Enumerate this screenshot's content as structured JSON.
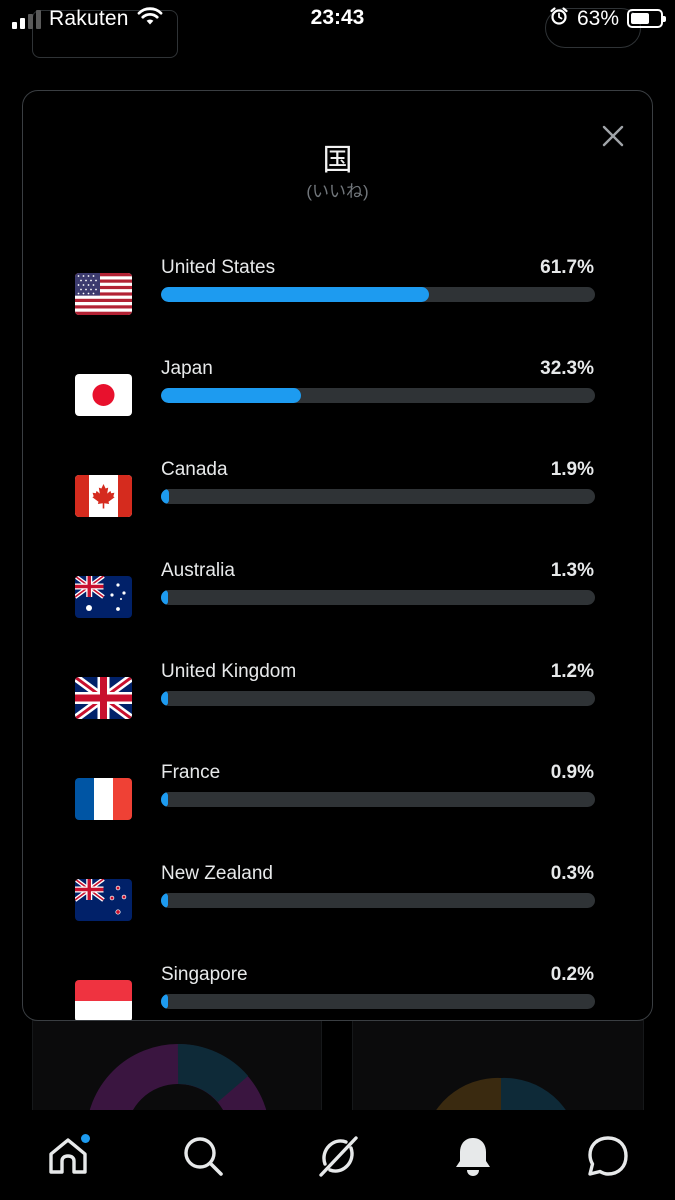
{
  "status_bar": {
    "carrier": "Rakuten",
    "time": "23:43",
    "battery": "63%",
    "battery_level": 0.63,
    "icons": [
      "signal-icon",
      "wifi-icon",
      "alarm-icon",
      "battery-icon"
    ]
  },
  "modal": {
    "title": "国",
    "subtitle": "(いいね)",
    "close_icon": "close-icon",
    "countries": [
      {
        "name": "United States",
        "percent": "61.7%",
        "value": 61.7,
        "flag": "us-flag-icon"
      },
      {
        "name": "Japan",
        "percent": "32.3%",
        "value": 32.3,
        "flag": "japan-flag-icon"
      },
      {
        "name": "Canada",
        "percent": "1.9%",
        "value": 1.9,
        "flag": "canada-flag-icon"
      },
      {
        "name": "Australia",
        "percent": "1.3%",
        "value": 1.3,
        "flag": "australia-flag-icon"
      },
      {
        "name": "United Kingdom",
        "percent": "1.2%",
        "value": 1.2,
        "flag": "uk-flag-icon"
      },
      {
        "name": "France",
        "percent": "0.9%",
        "value": 0.9,
        "flag": "france-flag-icon"
      },
      {
        "name": "New Zealand",
        "percent": "0.3%",
        "value": 0.3,
        "flag": "new-zealand-flag-icon"
      },
      {
        "name": "Singapore",
        "percent": "0.2%",
        "value": 0.2,
        "flag": "singapore-flag-icon"
      }
    ]
  },
  "tab_bar": {
    "items": [
      "home-icon",
      "search-icon",
      "grok-icon",
      "notifications-icon",
      "messages-icon"
    ],
    "home_has_badge": true
  },
  "colors": {
    "background": "#000000",
    "accent": "#1d9bf0",
    "track": "#2f3336",
    "text_primary": "#e7e9ea",
    "text_secondary": "#71767b"
  }
}
